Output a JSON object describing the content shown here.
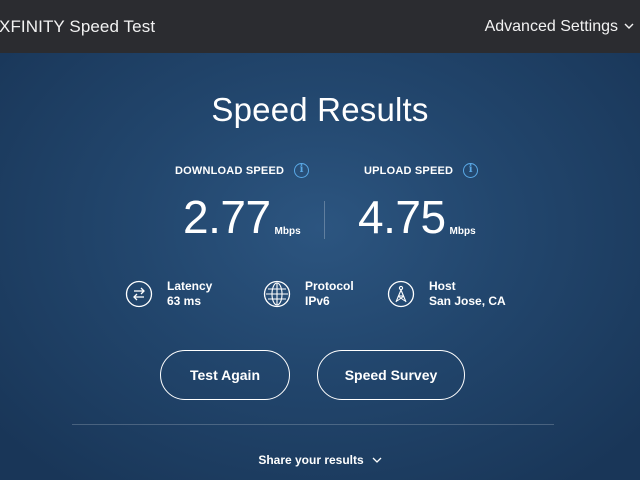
{
  "header": {
    "brand": "XFINITY Speed Test",
    "advanced_settings": "Advanced Settings"
  },
  "results": {
    "title": "Speed Results",
    "download": {
      "label": "DOWNLOAD SPEED",
      "value": "2.77",
      "unit": "Mbps"
    },
    "upload": {
      "label": "UPLOAD SPEED",
      "value": "4.75",
      "unit": "Mbps"
    },
    "info_glyph": "i"
  },
  "stats": {
    "latency": {
      "label": "Latency",
      "value": "63 ms",
      "icon": "swap-arrows-icon"
    },
    "protocol": {
      "label": "Protocol",
      "value": "IPv6",
      "icon": "globe-icon"
    },
    "host": {
      "label": "Host",
      "value": "San Jose, CA",
      "icon": "tower-icon"
    }
  },
  "actions": {
    "test_again": "Test Again",
    "speed_survey": "Speed Survey"
  },
  "share": {
    "label": "Share your results"
  },
  "colors": {
    "topbar": "#2b2c30",
    "background": "#22466d",
    "info_accent": "#5aa9e6",
    "text": "#ffffff"
  }
}
